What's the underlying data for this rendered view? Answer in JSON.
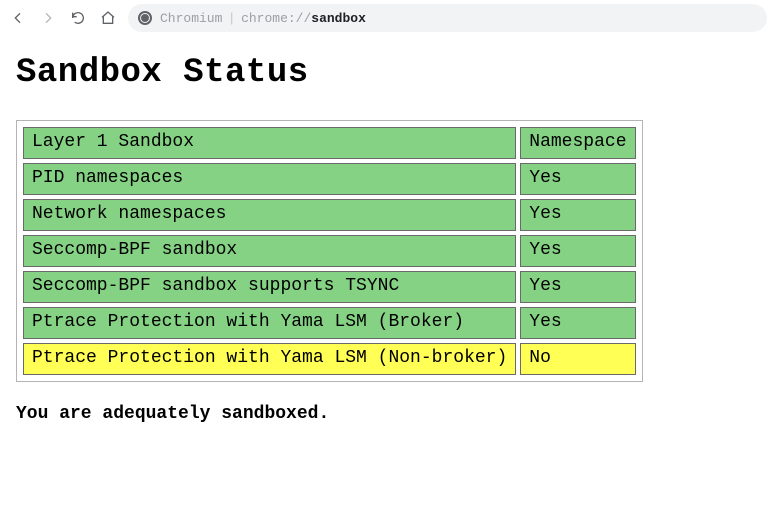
{
  "browser": {
    "url_scheme": "Chromium",
    "url_origin": "chrome://",
    "url_path": "sandbox"
  },
  "page": {
    "title": "Sandbox Status",
    "summary": "You are adequately sandboxed.",
    "rows": [
      {
        "label": "Layer 1 Sandbox",
        "value": "Namespace",
        "status": "ok"
      },
      {
        "label": "PID namespaces",
        "value": "Yes",
        "status": "ok"
      },
      {
        "label": "Network namespaces",
        "value": "Yes",
        "status": "ok"
      },
      {
        "label": "Seccomp-BPF sandbox",
        "value": "Yes",
        "status": "ok"
      },
      {
        "label": "Seccomp-BPF sandbox supports TSYNC",
        "value": "Yes",
        "status": "ok"
      },
      {
        "label": "Ptrace Protection with Yama LSM (Broker)",
        "value": "Yes",
        "status": "ok"
      },
      {
        "label": "Ptrace Protection with Yama LSM (Non-broker)",
        "value": "No",
        "status": "bad"
      }
    ]
  }
}
